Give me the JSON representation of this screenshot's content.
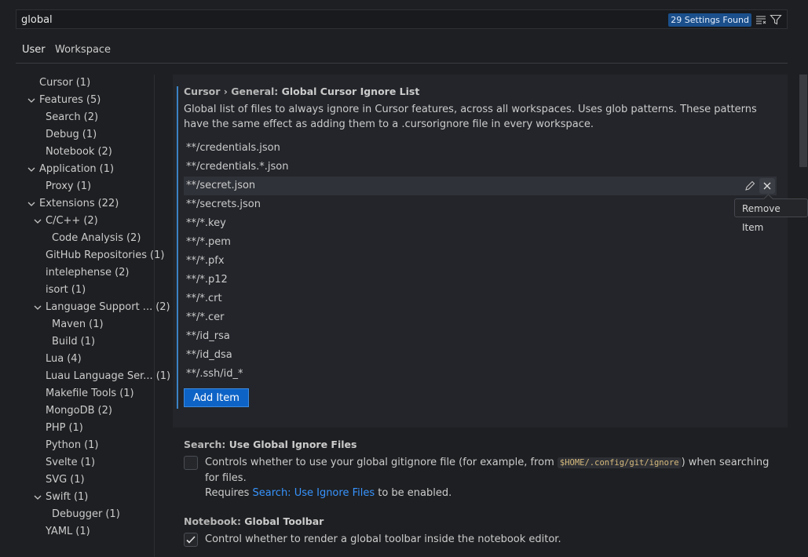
{
  "search": {
    "value": "global",
    "results_badge": "29 Settings Found"
  },
  "tabs": [
    {
      "label": "User"
    },
    {
      "label": "Workspace"
    }
  ],
  "toc": [
    {
      "label": "Cursor",
      "count": "(1)"
    },
    {
      "label": "Features",
      "count": "(5)"
    },
    {
      "label": "Search",
      "count": "(2)"
    },
    {
      "label": "Debug",
      "count": "(1)"
    },
    {
      "label": "Notebook",
      "count": "(2)"
    },
    {
      "label": "Application",
      "count": "(1)"
    },
    {
      "label": "Proxy",
      "count": "(1)"
    },
    {
      "label": "Extensions",
      "count": "(22)"
    },
    {
      "label": "C/C++",
      "count": "(2)"
    },
    {
      "label": "Code Analysis",
      "count": "(2)"
    },
    {
      "label": "GitHub Repositories",
      "count": "(1)"
    },
    {
      "label": "intelephense",
      "count": "(2)"
    },
    {
      "label": "isort",
      "count": "(1)"
    },
    {
      "label": "Language Support ...",
      "count": "(2)"
    },
    {
      "label": "Maven",
      "count": "(1)"
    },
    {
      "label": "Build",
      "count": "(1)"
    },
    {
      "label": "Lua",
      "count": "(4)"
    },
    {
      "label": "Luau Language Ser...",
      "count": "(1)"
    },
    {
      "label": "Makefile Tools",
      "count": "(1)"
    },
    {
      "label": "MongoDB",
      "count": "(2)"
    },
    {
      "label": "PHP",
      "count": "(1)"
    },
    {
      "label": "Python",
      "count": "(1)"
    },
    {
      "label": "Svelte",
      "count": "(1)"
    },
    {
      "label": "SVG",
      "count": "(1)"
    },
    {
      "label": "Swift",
      "count": "(1)"
    },
    {
      "label": "Debugger",
      "count": "(1)"
    },
    {
      "label": "YAML",
      "count": "(1)"
    }
  ],
  "ignore_list": {
    "category": "Cursor › General: ",
    "title": "Global Cursor Ignore List",
    "description": "Global list of files to always ignore in Cursor features, across all workspaces. Uses glob patterns. These patterns have the same effect as adding them to a .cursorignore file in every workspace.",
    "items": [
      "**/credentials.json",
      "**/credentials.*.json",
      "**/secret.json",
      "**/secrets.json",
      "**/*.key",
      "**/*.pem",
      "**/*.pfx",
      "**/*.p12",
      "**/*.crt",
      "**/*.cer",
      "**/id_rsa",
      "**/id_dsa",
      "**/.ssh/id_*"
    ],
    "remove_tooltip": "Remove Item",
    "add_label": "Add Item"
  },
  "global_ignore": {
    "category": "Search: ",
    "title": "Use Global Ignore Files",
    "desc_before": "Controls whether to use your global gitignore file (for example, from ",
    "code": "$HOME/.config/git/ignore",
    "desc_after": ") when searching for files.",
    "requires_prefix": "Requires ",
    "requires_link": "Search: Use Ignore Files",
    "requires_suffix": " to be enabled.",
    "checked": false
  },
  "notebook_toolbar": {
    "category": "Notebook: ",
    "title": "Global Toolbar",
    "desc": "Control whether to render a global toolbar inside the notebook editor.",
    "checked": true
  },
  "colors": {
    "accent": "#0e63c6",
    "badge": "#1a4f8b",
    "link": "#3794ff"
  }
}
